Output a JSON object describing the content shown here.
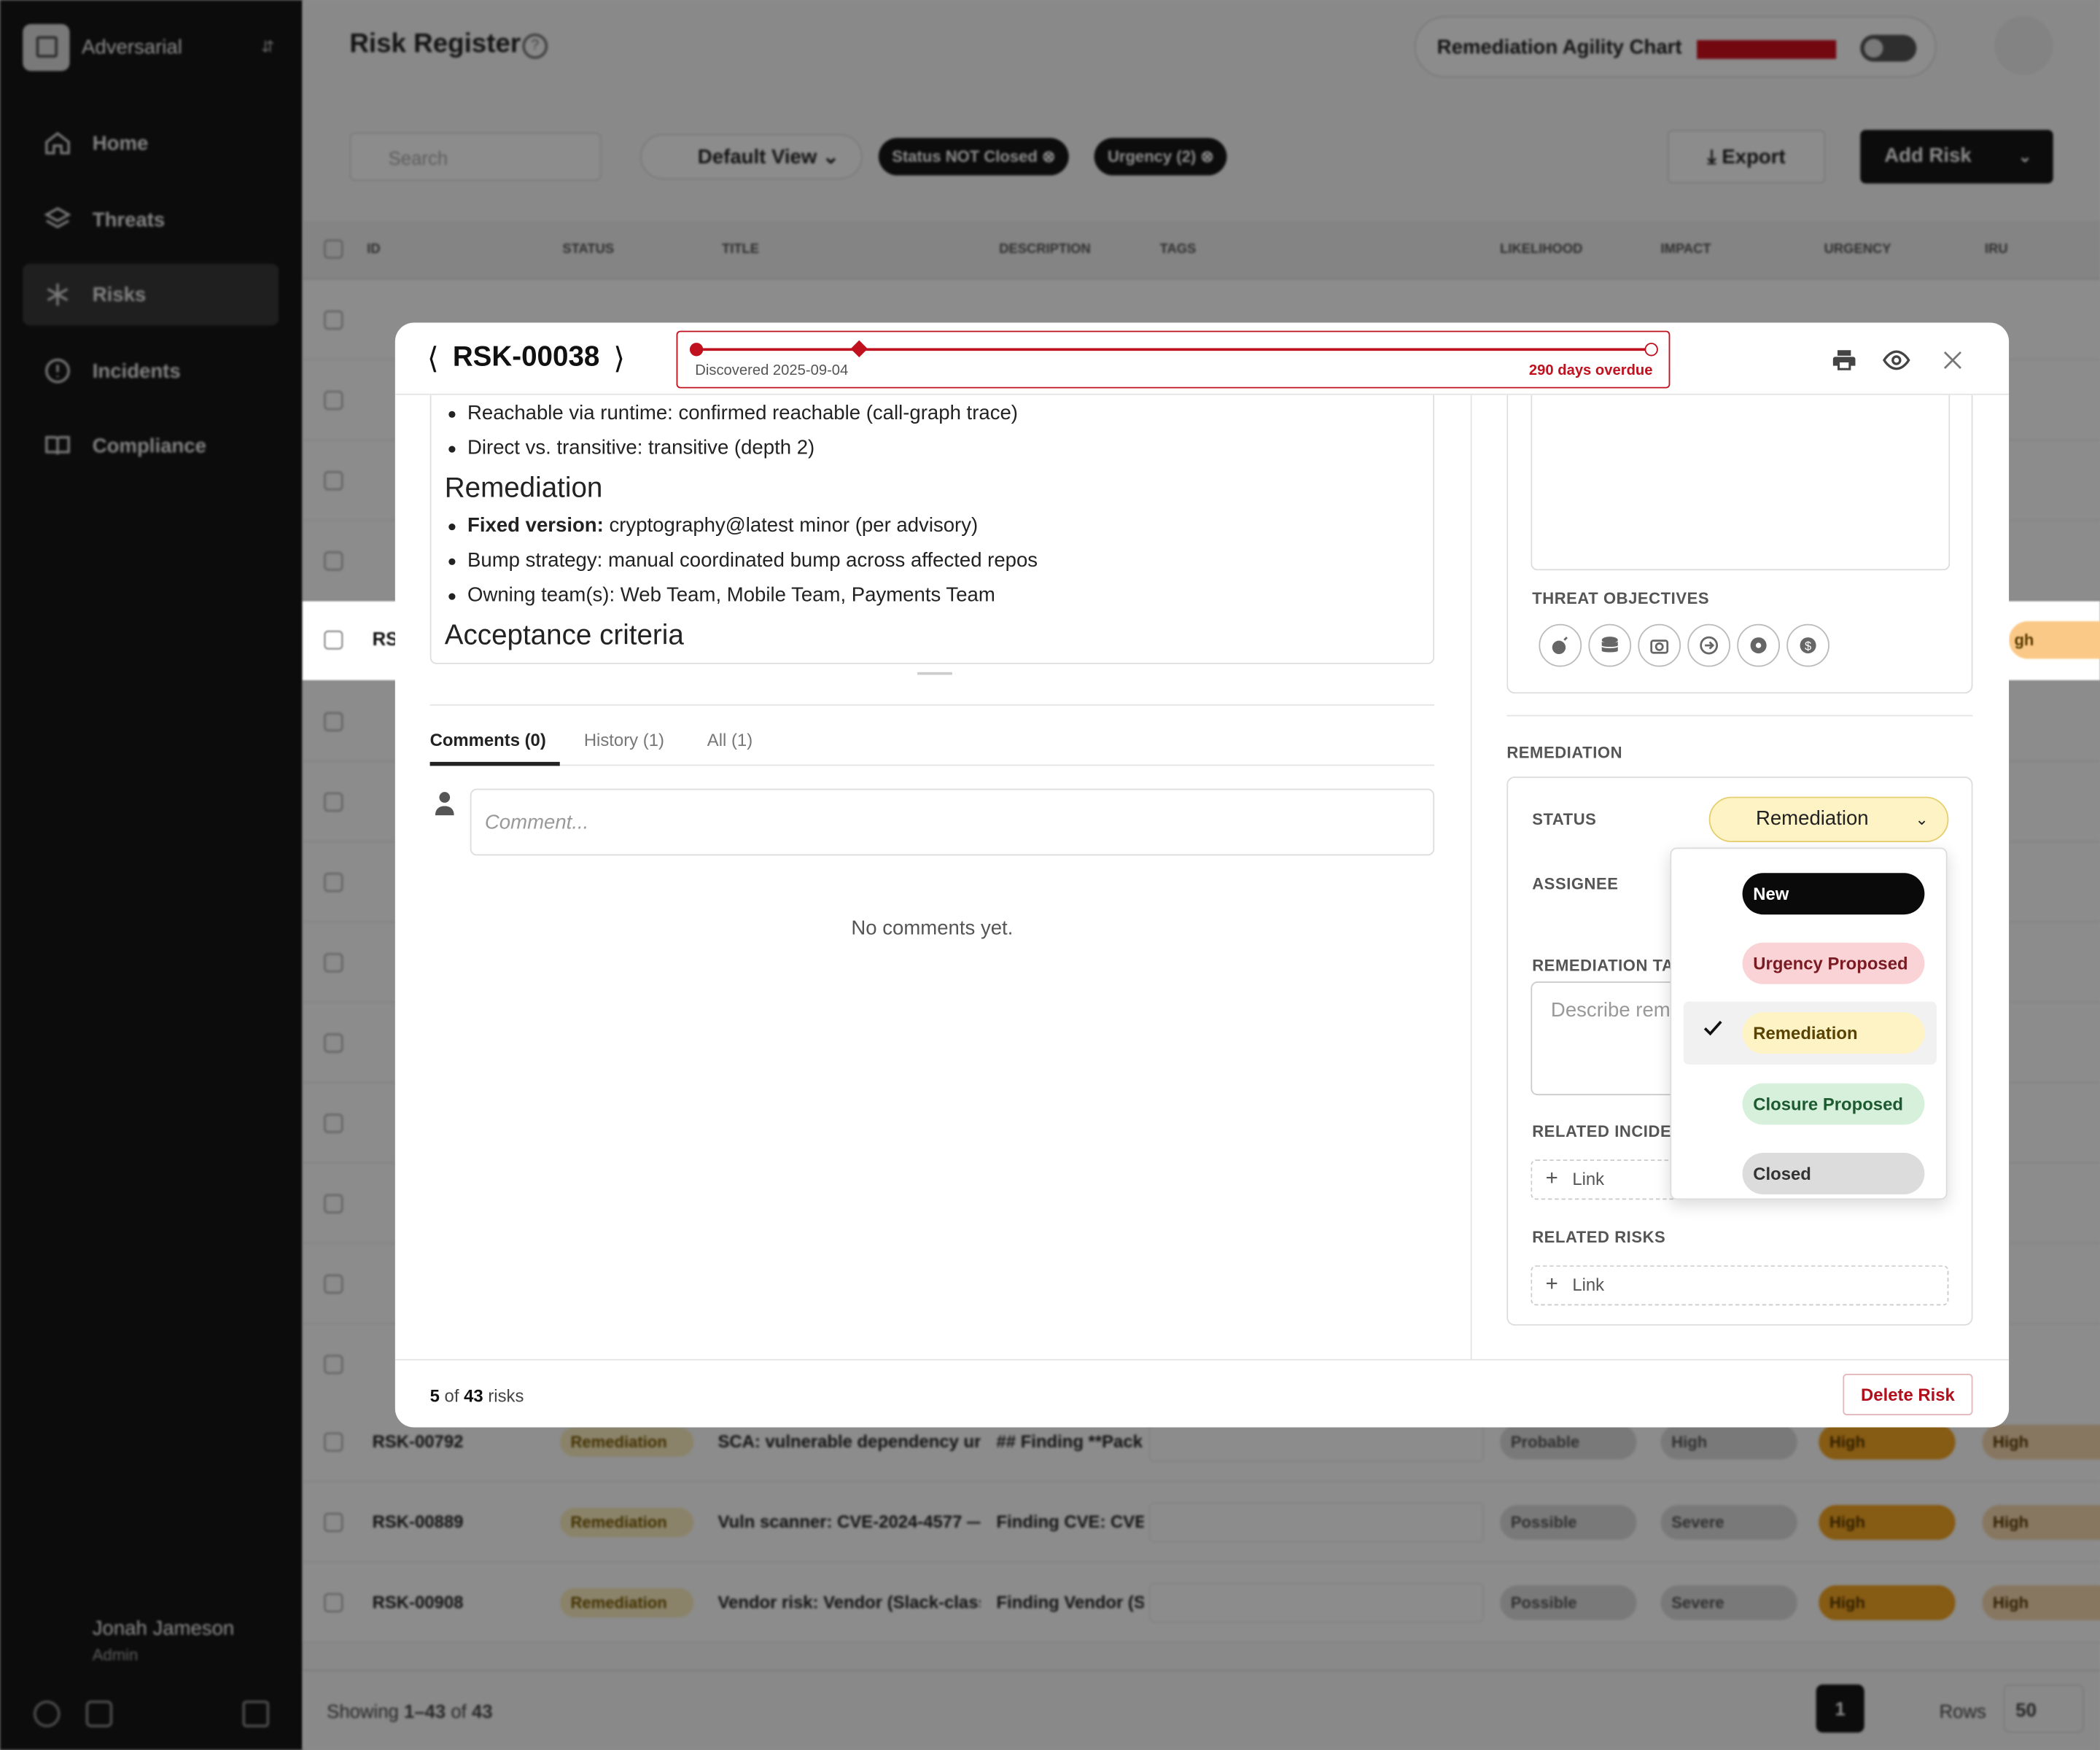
{
  "sidebar": {
    "workspace": "Adversarial",
    "items": [
      {
        "label": "Home",
        "icon": "home-icon"
      },
      {
        "label": "Threats",
        "icon": "layers-icon"
      },
      {
        "label": "Risks",
        "icon": "asterisk-icon",
        "active": true
      },
      {
        "label": "Incidents",
        "icon": "alert-circle-icon"
      },
      {
        "label": "Compliance",
        "icon": "book-icon"
      }
    ],
    "user": {
      "name": "Jonah Jameson",
      "role": "Admin"
    }
  },
  "header": {
    "title": "Risk Register",
    "agility_label": "Remediation Agility Chart"
  },
  "toolbar": {
    "search_placeholder": "Search",
    "view": "Default View",
    "filters": [
      "Status NOT Closed",
      "Urgency (2)"
    ],
    "export": "Export",
    "add_risk": "Add Risk"
  },
  "table": {
    "columns": [
      "ID",
      "STATUS",
      "TITLE",
      "DESCRIPTION",
      "TAGS",
      "LIKELIHOOD",
      "IMPACT",
      "URGENCY",
      "IRU"
    ],
    "rows": [
      {
        "id": "RSK-00792",
        "status": "Remediation",
        "title": "SCA: vulnerable dependency url",
        "desc": "## Finding **Pack",
        "likelihood": "Probable",
        "impact": "High",
        "urgency": "High",
        "iru": "High"
      },
      {
        "id": "RSK-00889",
        "status": "Remediation",
        "title": "Vuln scanner: CVE-2024-4577 —",
        "desc": "Finding CVE: CVE-",
        "likelihood": "Possible",
        "impact": "Severe",
        "urgency": "High",
        "iru": "High"
      },
      {
        "id": "RSK-00908",
        "status": "Remediation",
        "title": "Vendor risk: Vendor (Slack-class",
        "desc": "Finding Vendor (S",
        "likelihood": "Possible",
        "impact": "Severe",
        "urgency": "High",
        "iru": "High"
      }
    ],
    "highlight_row": {
      "id": "RS",
      "iru": "gh"
    },
    "footer": {
      "showing": "Showing",
      "range": "1–43",
      "of": "of",
      "total": "43",
      "page": "1",
      "rows_label": "Rows",
      "rows_value": "50"
    }
  },
  "modal": {
    "id": "RSK-00038",
    "timeline": {
      "start": "Discovered 2025-09-04",
      "overdue": "290 days overdue"
    },
    "description": {
      "bullets_top": [
        "Reachable via runtime: confirmed reachable (call-graph trace)",
        "Direct vs. transitive: transitive (depth 2)"
      ],
      "h_remediation": "Remediation",
      "fixed_label": "Fixed version:",
      "fixed_value": " cryptography@latest minor (per advisory)",
      "bullets_rem": [
        "Bump strategy: manual coordinated bump across affected repos",
        "Owning team(s): Web Team, Mobile Team, Payments Team"
      ],
      "h_acceptance": "Acceptance criteria"
    },
    "tabs": [
      "Comments (0)",
      "History (1)",
      "All (1)"
    ],
    "comment_placeholder": "Comment...",
    "no_comments": "No comments yet.",
    "threat_objectives_label": "THREAT OBJECTIVES",
    "threat_objectives": [
      "bomb-icon",
      "database-icon",
      "camera-icon",
      "arrow-right-circle-icon",
      "gear-icon",
      "dollar-icon"
    ],
    "remediation_label": "REMEDIATION",
    "status_label": "STATUS",
    "status_value": "Remediation",
    "assignee_label": "ASSIGNEE",
    "remediation_tasks_label": "REMEDIATION TA",
    "remediation_tasks_placeholder": "Describe rem",
    "related_incidents_label": "RELATED INCIDE",
    "related_risks_label": "RELATED RISKS",
    "link_label": "Link",
    "status_options": [
      {
        "label": "New",
        "bg": "#0a0a0a",
        "fg": "#ffffff"
      },
      {
        "label": "Urgency Proposed",
        "bg": "#f9d3d6",
        "fg": "#7a1a22"
      },
      {
        "label": "Remediation",
        "bg": "#fdf3c4",
        "fg": "#5a4300",
        "selected": true
      },
      {
        "label": "Closure Proposed",
        "bg": "#d6f0dc",
        "fg": "#1d5a2f"
      },
      {
        "label": "Closed",
        "bg": "#dcdcdc",
        "fg": "#333333"
      }
    ],
    "footer": {
      "position": "5",
      "of": "of",
      "total": "43",
      "unit": "risks",
      "delete": "Delete Risk"
    }
  }
}
